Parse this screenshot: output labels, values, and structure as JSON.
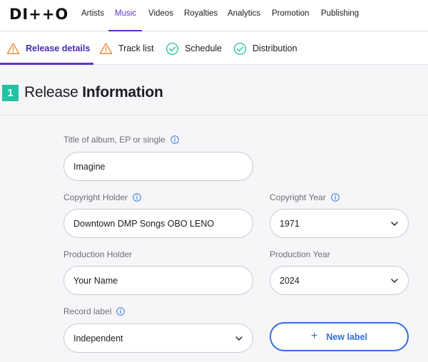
{
  "nav": {
    "logo": "DI++O",
    "items": [
      "Artists",
      "Music",
      "Videos",
      "Royalties",
      "Analytics",
      "Promotion",
      "Publishing"
    ],
    "active": "Music",
    "accent": "#5b33c8"
  },
  "steps": [
    {
      "label": "Release details",
      "status": "warning",
      "icon": "warning-icon",
      "active": true
    },
    {
      "label": "Track list",
      "status": "warning",
      "icon": "warning-icon",
      "active": false
    },
    {
      "label": "Schedule",
      "status": "complete",
      "icon": "check-circle-icon",
      "active": false
    },
    {
      "label": "Distribution",
      "status": "complete",
      "icon": "check-circle-icon",
      "active": false
    }
  ],
  "section": {
    "number": "1",
    "title_light": "Release ",
    "title_bold": "Information"
  },
  "form": {
    "title": {
      "label": "Title of album, EP or single",
      "value": "Imagine"
    },
    "copyright_holder": {
      "label": "Copyright Holder",
      "value": "Downtown DMP Songs OBO LENO"
    },
    "copyright_year": {
      "label": "Copyright Year",
      "value": "1971"
    },
    "production_holder": {
      "label": "Production Holder",
      "value": "Your Name"
    },
    "production_year": {
      "label": "Production Year",
      "value": "2024"
    },
    "record_label": {
      "label": "Record label",
      "value": "Independent"
    },
    "new_label_button": "New label"
  },
  "colors": {
    "warning": "#e8832a",
    "complete": "#22c2a2",
    "link": "#2f6fd8",
    "info": "#3b7be0"
  }
}
